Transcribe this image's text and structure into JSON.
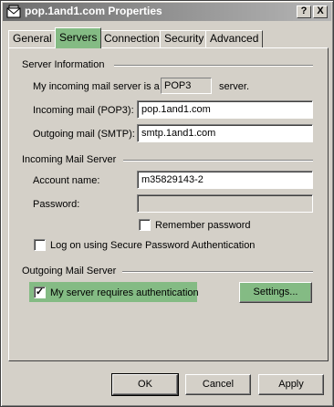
{
  "window": {
    "title": "pop.1and1.com Properties",
    "help_button": "?",
    "close_button": "X"
  },
  "tabs": [
    {
      "label": "General"
    },
    {
      "label": "Servers"
    },
    {
      "label": "Connection"
    },
    {
      "label": "Security"
    },
    {
      "label": "Advanced"
    }
  ],
  "active_tab": "Servers",
  "server_info": {
    "group_title": "Server Information",
    "incoming_type_prefix": "My incoming mail server is a",
    "incoming_type_value": "POP3",
    "incoming_type_suffix": "server.",
    "incoming_label": "Incoming mail (POP3):",
    "incoming_value": "pop.1and1.com",
    "outgoing_label": "Outgoing mail (SMTP):",
    "outgoing_value": "smtp.1and1.com"
  },
  "incoming_server": {
    "group_title": "Incoming Mail Server",
    "account_label": "Account name:",
    "account_value": "m35829143-2",
    "password_label": "Password:",
    "password_value": "",
    "remember_label": "Remember password",
    "remember_checked": false,
    "spa_label": "Log on using Secure Password Authentication",
    "spa_checked": false
  },
  "outgoing_server": {
    "group_title": "Outgoing Mail Server",
    "auth_label": "My server requires authentication",
    "auth_checked": true,
    "settings_button": "Settings..."
  },
  "footer": {
    "ok": "OK",
    "cancel": "Cancel",
    "apply": "Apply"
  },
  "colors": {
    "highlight": "#84bb84",
    "titlebar_start": "#6d6d6d",
    "face": "#d4d0c8"
  }
}
